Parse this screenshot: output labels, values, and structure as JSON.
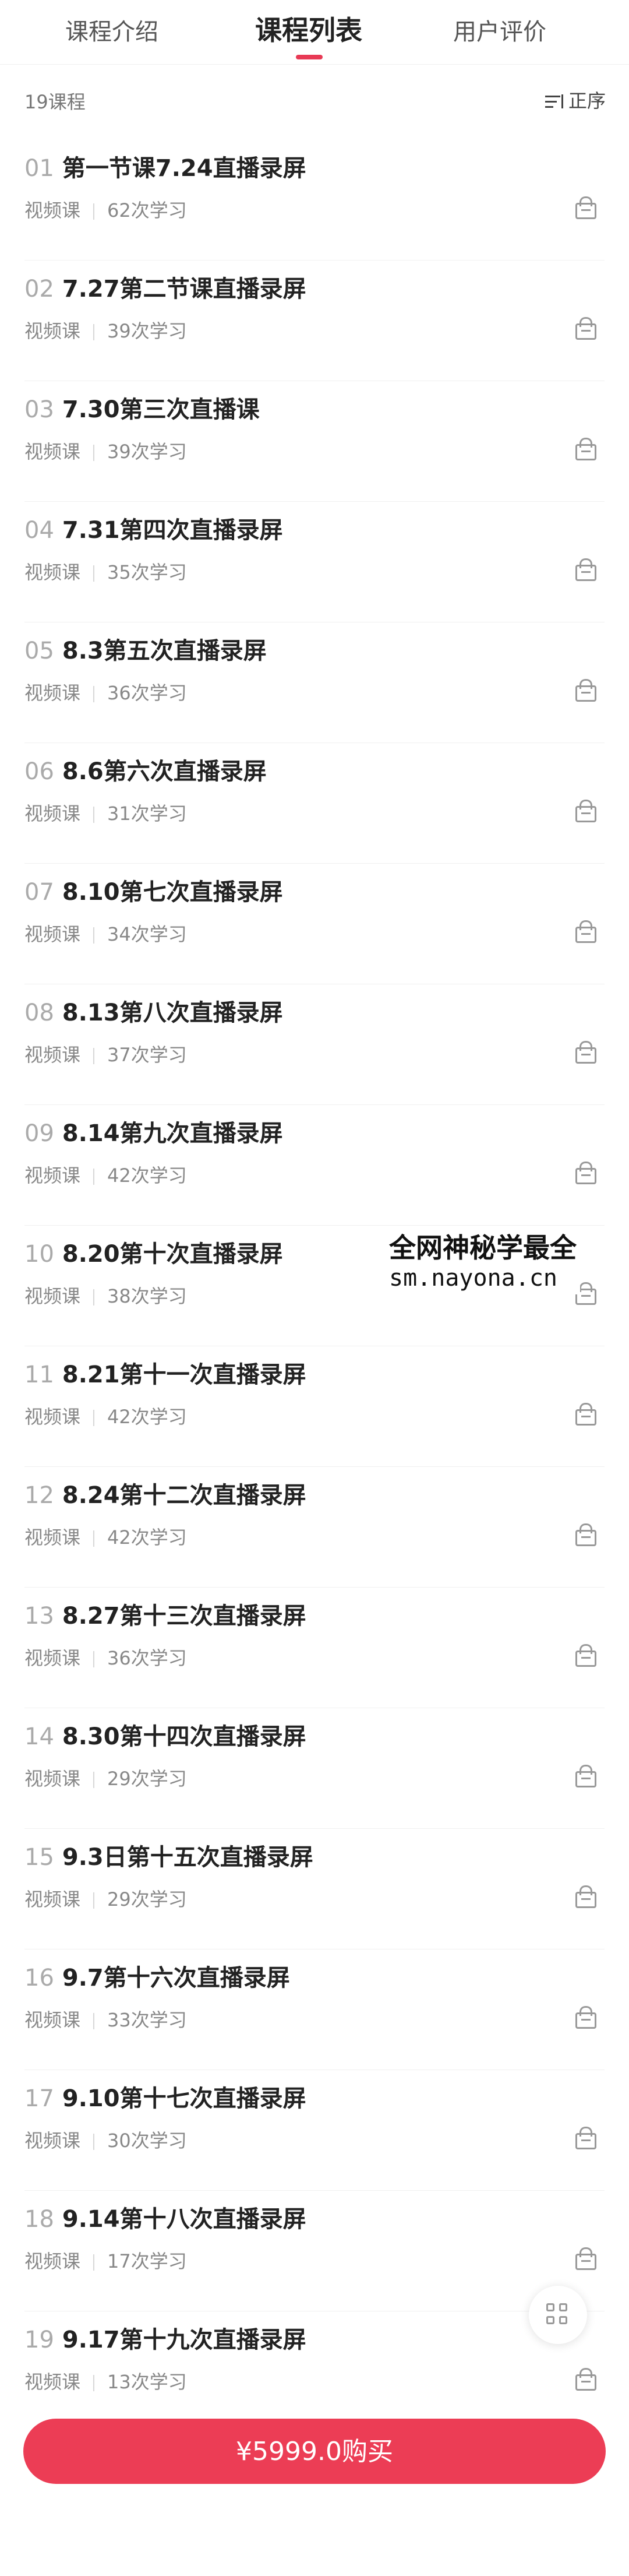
{
  "tabs": [
    {
      "label": "课程介绍"
    },
    {
      "label": "课程列表"
    },
    {
      "label": "用户评价"
    }
  ],
  "toolbar": {
    "count": "19课程",
    "sort_label": "正序"
  },
  "courses": [
    {
      "num": "01",
      "title": "第一节课7.24直播录屏",
      "type": "视频课",
      "views": "62次学习"
    },
    {
      "num": "02",
      "title": "7.27第二节课直播录屏",
      "type": "视频课",
      "views": "39次学习"
    },
    {
      "num": "03",
      "title": "7.30第三次直播课",
      "type": "视频课",
      "views": "39次学习"
    },
    {
      "num": "04",
      "title": "7.31第四次直播录屏",
      "type": "视频课",
      "views": "35次学习"
    },
    {
      "num": "05",
      "title": "8.3第五次直播录屏",
      "type": "视频课",
      "views": "36次学习"
    },
    {
      "num": "06",
      "title": "8.6第六次直播录屏",
      "type": "视频课",
      "views": "31次学习"
    },
    {
      "num": "07",
      "title": "8.10第七次直播录屏",
      "type": "视频课",
      "views": "34次学习"
    },
    {
      "num": "08",
      "title": "8.13第八次直播录屏",
      "type": "视频课",
      "views": "37次学习"
    },
    {
      "num": "09",
      "title": "8.14第九次直播录屏",
      "type": "视频课",
      "views": "42次学习"
    },
    {
      "num": "10",
      "title": "8.20第十次直播录屏",
      "type": "视频课",
      "views": "38次学习"
    },
    {
      "num": "11",
      "title": "8.21第十一次直播录屏",
      "type": "视频课",
      "views": "42次学习"
    },
    {
      "num": "12",
      "title": "8.24第十二次直播录屏",
      "type": "视频课",
      "views": "42次学习"
    },
    {
      "num": "13",
      "title": "8.27第十三次直播录屏",
      "type": "视频课",
      "views": "36次学习"
    },
    {
      "num": "14",
      "title": "8.30第十四次直播录屏",
      "type": "视频课",
      "views": "29次学习"
    },
    {
      "num": "15",
      "title": "9.3日第十五次直播录屏",
      "type": "视频课",
      "views": "29次学习"
    },
    {
      "num": "16",
      "title": "9.7第十六次直播录屏",
      "type": "视频课",
      "views": "33次学习"
    },
    {
      "num": "17",
      "title": "9.10第十七次直播录屏",
      "type": "视频课",
      "views": "30次学习"
    },
    {
      "num": "18",
      "title": "9.14第十八次直播录屏",
      "type": "视频课",
      "views": "17次学习"
    },
    {
      "num": "19",
      "title": "9.17第十九次直播录屏",
      "type": "视频课",
      "views": "13次学习"
    }
  ],
  "watermark": {
    "line1": "全网神秘学最全",
    "line2": "sm.nayona.cn"
  },
  "buy": {
    "label": "¥5999.0购买"
  },
  "colors": {
    "accent": "#ec3d55",
    "text": "#222222",
    "muted": "#888888"
  }
}
